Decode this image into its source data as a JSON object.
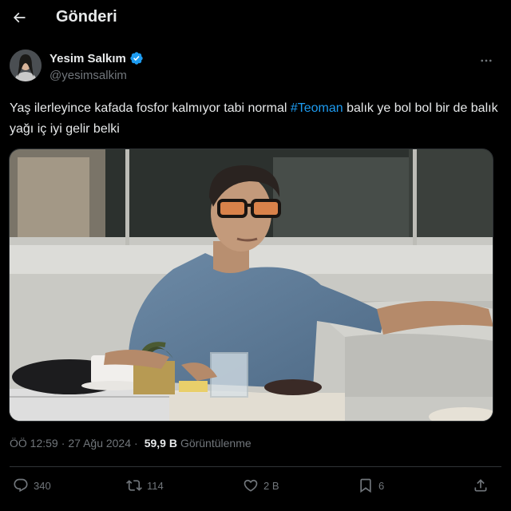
{
  "header": {
    "title": "Gönderi",
    "back_icon": "arrow-left-icon"
  },
  "author": {
    "display_name": "Yesim Salkım",
    "handle": "@yesimsalkim",
    "verified_icon": "verified-badge-icon",
    "verified_color": "#1d9bf0"
  },
  "tweet": {
    "text_before": "Yaş ilerleyince kafada fosfor kalmıyor tabi normal ",
    "hashtag": "#Teoman",
    "text_after": " balık ye bol bol bir de balık yağı iç iyi gelir belki"
  },
  "meta": {
    "time": "ÖÖ 12:59",
    "separator": "·",
    "date": "27 Ağu 2024",
    "separator2": "·",
    "views_count": "59,9 B",
    "views_label": "Görüntülenme"
  },
  "actions": {
    "replies": "340",
    "reposts": "114",
    "likes": "2 B",
    "bookmarks": "6"
  },
  "colors": {
    "background": "#000000",
    "text": "#e7e9ea",
    "muted": "#71767b",
    "accent": "#1d9bf0",
    "border": "#2f3336"
  }
}
